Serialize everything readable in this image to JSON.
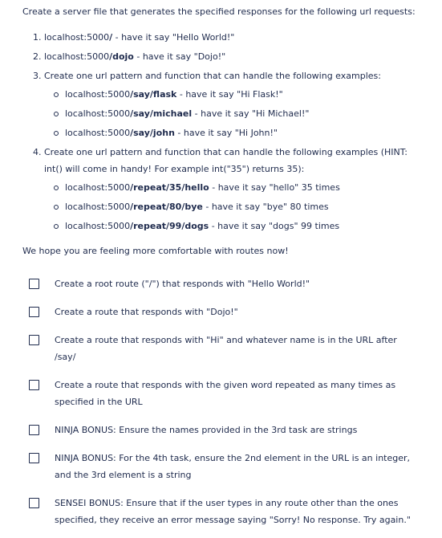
{
  "intro": "Create a server file that generates the specified responses for the following url requests:",
  "tasks": [
    {
      "pre": "localhost:5000",
      "path": "/",
      "post": " - have it say \"Hello World!\""
    },
    {
      "pre": "localhost:5000",
      "path": "/dojo",
      "post": " - have it say \"Dojo!\""
    },
    {
      "text": "Create one url pattern and function that can handle the following examples:",
      "subs": [
        {
          "pre": "localhost:5000",
          "path": "/say/flask",
          "post": " - have it say \"Hi Flask!\""
        },
        {
          "pre": "localhost:5000",
          "path": "/say/michael",
          "post": " - have it say \"Hi Michael!\""
        },
        {
          "pre": "localhost:5000",
          "path": "/say/john",
          "post": " - have it say \"Hi John!\""
        }
      ]
    },
    {
      "text": "Create one url pattern and function that can handle the following examples (HINT: int() will come in handy! For example int(\"35\") returns 35):",
      "subs": [
        {
          "pre": "localhost:5000",
          "path": "/repeat/35/hello",
          "post": " - have it say \"hello\" 35 times"
        },
        {
          "pre": "localhost:5000",
          "path": "/repeat/80/bye",
          "post": " - have it say \"bye\" 80 times"
        },
        {
          "pre": "localhost:5000",
          "path": "/repeat/99/dogs",
          "post": " - have it say \"dogs\" 99 times"
        }
      ]
    }
  ],
  "outro": "We hope you are feeling more comfortable with routes now!",
  "checklist": [
    "Create a root route (\"/\") that responds with \"Hello World!\"",
    "Create a route that responds with \"Dojo!\"",
    "Create a route that responds with \"Hi\" and whatever name is in the URL after /say/",
    "Create a route that responds with the given word repeated as many times as specified in the URL",
    "NINJA BONUS: Ensure the names provided in the 3rd task are strings",
    "NINJA BONUS: For the 4th task, ensure the 2nd element in the URL is an integer, and the 3rd element is a string",
    "SENSEI BONUS: Ensure that if the user types in any route other than the ones specified, they receive an error message saying \"Sorry! No response. Try again.\""
  ]
}
